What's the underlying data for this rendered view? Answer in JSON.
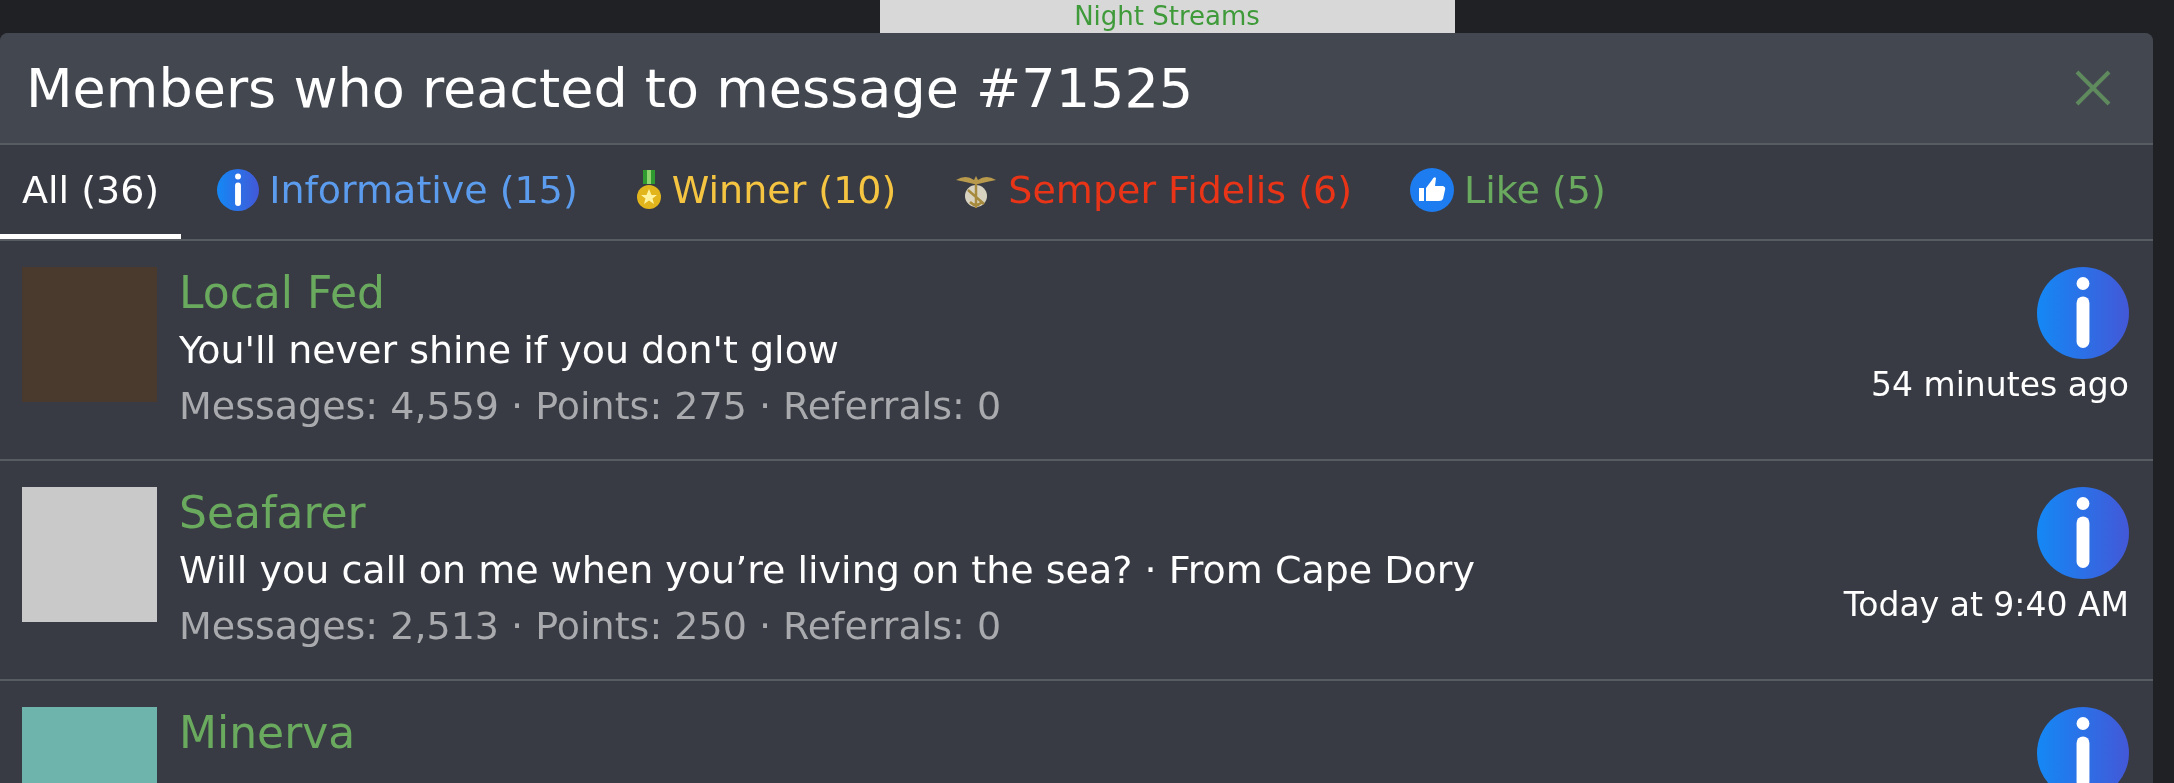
{
  "background": {
    "banner": "Night Streams"
  },
  "dialog": {
    "title": "Members who reacted to message #71525"
  },
  "tabs": [
    {
      "label": "All (36)",
      "kind": "all",
      "selected": true
    },
    {
      "label": "Informative (15)",
      "kind": "informative",
      "color": "#5c9cef",
      "selected": false
    },
    {
      "label": "Winner (10)",
      "kind": "winner",
      "color": "#f5c542",
      "selected": false
    },
    {
      "label": "Semper Fidelis (6)",
      "kind": "semper",
      "color": "#ea3418",
      "selected": false
    },
    {
      "label": "Like (5)",
      "kind": "like",
      "color": "#6aaa5e",
      "selected": false
    }
  ],
  "members": [
    {
      "name": "Local Fed",
      "title": "You'll never shine if you don't glow",
      "stats": "Messages: 4,559 · Points: 275 · Referrals: 0",
      "kind": "informative",
      "time": "54 minutes ago"
    },
    {
      "name": "Seafarer",
      "title": "Will you call on me when you’re living on the sea? · From Cape Dory",
      "stats": "Messages: 2,513 · Points: 250 · Referrals: 0",
      "kind": "informative",
      "time": "Today at 9:40 AM"
    },
    {
      "name": "Minerva",
      "kind": "informative"
    }
  ]
}
